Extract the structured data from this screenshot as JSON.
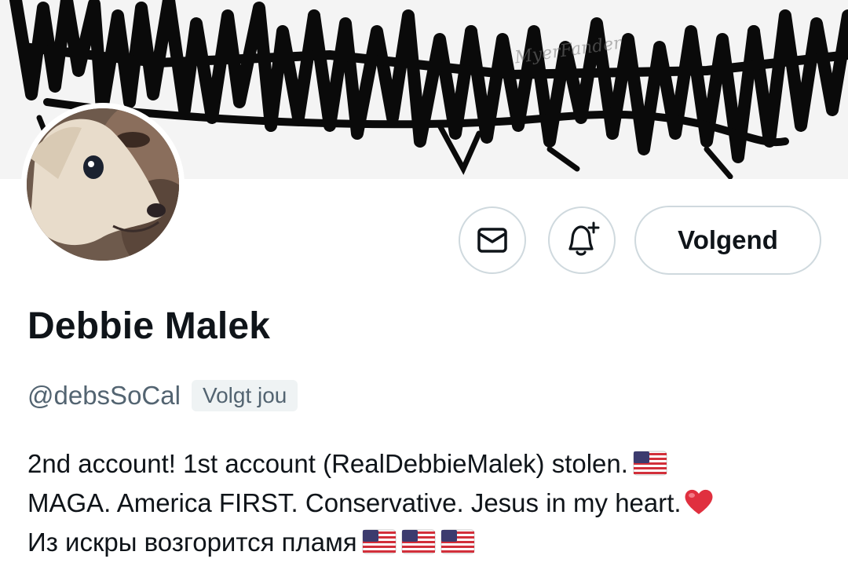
{
  "profile": {
    "banner_watermark": "MyerFander",
    "display_name": "Debbie Malek",
    "handle": "@debsSoCal",
    "follows_you_badge": "Volgt jou",
    "bio_line1": "2nd account! 1st account (RealDebbieMalek) stolen.",
    "bio_line2": "MAGA. America FIRST. Conservative. Jesus in my heart.",
    "bio_line3": "Из искры возгорится пламя"
  },
  "actions": {
    "message_icon": "envelope-icon",
    "notify_icon": "bell-plus-icon",
    "follow_label": "Volgend"
  },
  "colors": {
    "text_primary": "#0f1419",
    "text_secondary": "#536471",
    "border": "#cfd9de",
    "badge_bg": "#eff3f4"
  }
}
